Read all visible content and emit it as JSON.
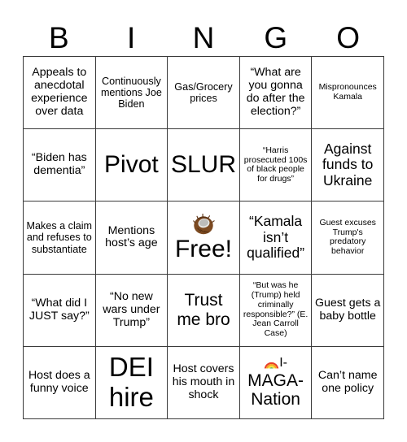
{
  "header": {
    "letters": [
      "B",
      "I",
      "N",
      "G",
      "O"
    ]
  },
  "grid": {
    "rows": [
      [
        {
          "text": "Appeals to anecdotal experience over data",
          "size": "fs-md"
        },
        {
          "text": "Continuously mentions Joe Biden",
          "size": "fs-sm"
        },
        {
          "text": "Gas/Grocery prices",
          "size": "fs-sm"
        },
        {
          "text": "“What are you gonna do after the election?”",
          "size": "fs-md"
        },
        {
          "text": "Mispronounces Kamala",
          "size": "fs-xs"
        }
      ],
      [
        {
          "text": "“Biden has dementia”",
          "size": "fs-md"
        },
        {
          "text": "Pivot",
          "size": "fs-xxl"
        },
        {
          "text": "SLUR",
          "size": "fs-xxl"
        },
        {
          "text": "“Harris prosecuted 100s of black people for drugs”",
          "size": "fs-xs"
        },
        {
          "text": "Against funds to Ukraine",
          "size": "fs-lg"
        }
      ],
      [
        {
          "text": "Makes a claim and refuses to substantiate",
          "size": "fs-sm"
        },
        {
          "text": "Mentions host’s age",
          "size": "fs-md"
        },
        {
          "text": "Free!",
          "size": "fs-xxl",
          "free": true,
          "emoji": "coconut-emoji"
        },
        {
          "text": "“Kamala isn’t qualified”",
          "size": "fs-lg"
        },
        {
          "text": "Guest excuses Trump's predatory behavior",
          "size": "fs-xs"
        }
      ],
      [
        {
          "text": "“What did I JUST say?”",
          "size": "fs-md"
        },
        {
          "text": "“No new wars under Trump”",
          "size": "fs-md"
        },
        {
          "text": "Trust me bro",
          "size": "fs-xl"
        },
        {
          "text": "“But was he (Trump) held criminally responsible?” (E. Jean Carroll Case)",
          "size": "fs-xs"
        },
        {
          "text": "Guest gets a baby bottle",
          "size": "fs-md"
        }
      ],
      [
        {
          "text": "Host does a funny voice",
          "size": "fs-md"
        },
        {
          "text": "DEI hire",
          "size": "fs-huge"
        },
        {
          "text": "Host covers his mouth in shock",
          "size": "fs-md"
        },
        {
          "text": "I-MAGA-Nation",
          "size": "fs-xl",
          "rainbow": true,
          "emoji": "rainbow-emoji",
          "prefix": "I-",
          "lines": [
            "I-",
            "MAGA-",
            "Nation"
          ]
        },
        {
          "text": "Can’t name one policy",
          "size": "fs-md"
        }
      ]
    ]
  },
  "colors": {
    "background": "#ffffff",
    "text": "#000000",
    "border": "#3a3a3a"
  }
}
